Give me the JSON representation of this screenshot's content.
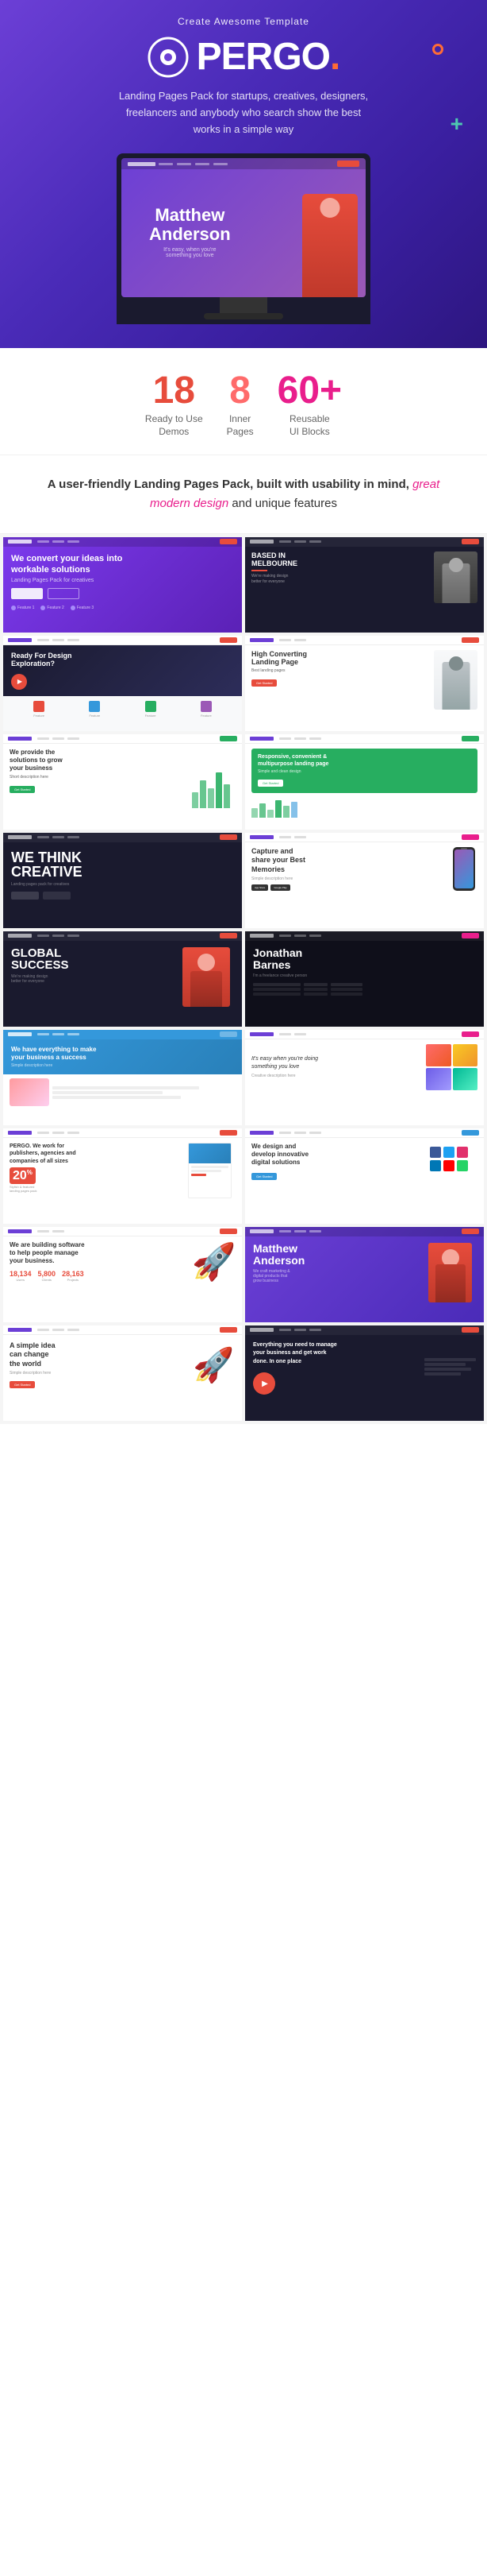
{
  "header": {
    "tagline": "Create Awesome Template",
    "logo_text": "PERGO",
    "logo_dot": ".",
    "description": "Landing Pages Pack for startups, creatives, designers, freelancers and anybody who search show the best works in a simple way",
    "monitor_name": "Matthew Anderson",
    "monitor_sub": "It's easy, when you're something you love"
  },
  "stats": {
    "stat1": {
      "number": "18",
      "label": "Ready to Use\nDemos"
    },
    "stat2": {
      "number": "8",
      "label": "Inner\nPages"
    },
    "stat3": {
      "number": "60+",
      "label": "Reusable\nUI Blocks"
    }
  },
  "intro": {
    "text_before": "A user-friendly Landing Pages Pack, built with usability in mind,",
    "text_emphasis": " great modern design",
    "text_after": " and unique features"
  },
  "demos": [
    {
      "id": 1,
      "name": "workable-solutions",
      "title": "We convert your ideas into workable solutions",
      "theme": "purple"
    },
    {
      "id": 2,
      "name": "based-in-melbourne",
      "title": "BASED IN MELBOURNE",
      "theme": "dark"
    },
    {
      "id": 3,
      "name": "ready-for-design",
      "title": "Ready For Design Exploration?",
      "theme": "light"
    },
    {
      "id": 4,
      "name": "high-converting",
      "title": "High Converting Landing Page",
      "theme": "light"
    },
    {
      "id": 5,
      "name": "provide-solutions",
      "title": "We provide the solutions to grow your business",
      "theme": "light"
    },
    {
      "id": 6,
      "name": "responsive-multipurpose",
      "title": "Responsive, convenient & multipurpose landing page",
      "theme": "green"
    },
    {
      "id": 7,
      "name": "we-think-creative",
      "title": "WE THINK CREATIVE",
      "theme": "dark"
    },
    {
      "id": 8,
      "name": "capture-memories",
      "title": "Capture and share your Best Memories",
      "theme": "light"
    },
    {
      "id": 9,
      "name": "global-success",
      "title": "GLOBAL SUCCESS",
      "theme": "dark"
    },
    {
      "id": 10,
      "name": "jonathan-barnes",
      "title": "Jonathan Barnes",
      "theme": "dark"
    },
    {
      "id": 11,
      "name": "business-success",
      "title": "We have everything to make your business a success",
      "theme": "blue"
    },
    {
      "id": 12,
      "name": "doing-something",
      "title": "It's easy when you're doing something you love",
      "theme": "light"
    },
    {
      "id": 13,
      "name": "pergo-work",
      "title": "PERGO. We work for publishers, agencies and companies of all sizes",
      "theme": "light-red"
    },
    {
      "id": 14,
      "name": "design-develop",
      "title": "We design and develop innovative digital solutions",
      "theme": "light"
    },
    {
      "id": 15,
      "name": "software-building",
      "title": "We are building software to help people manage your business.",
      "theme": "light"
    },
    {
      "id": 16,
      "name": "matthew-anderson-purple",
      "title": "Matthew Anderson",
      "theme": "purple"
    },
    {
      "id": 17,
      "name": "simple-idea",
      "title": "A simple idea can change the world",
      "theme": "light"
    },
    {
      "id": 18,
      "name": "manage-business",
      "title": "Everything you need to manage your business and get work done. In one place",
      "theme": "dark"
    }
  ]
}
